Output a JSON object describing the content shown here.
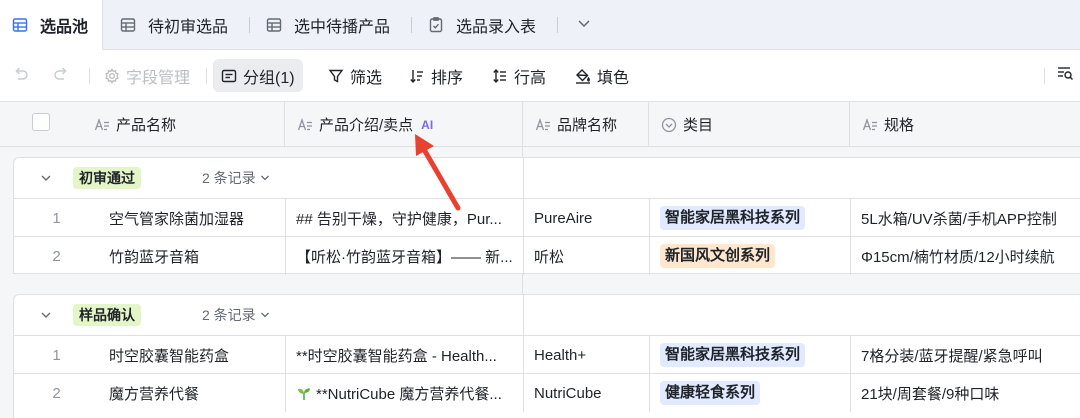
{
  "tabs": [
    {
      "label": "选品池",
      "icon": "table-icon",
      "active": true
    },
    {
      "label": "待初审选品",
      "icon": "table-icon",
      "active": false
    },
    {
      "label": "选中待播产品",
      "icon": "table-icon",
      "active": false
    },
    {
      "label": "选品录入表",
      "icon": "form-icon",
      "active": false
    }
  ],
  "toolbar": {
    "field_manage": "字段管理",
    "group": "分组(1)",
    "filter": "筛选",
    "sort": "排序",
    "row_height": "行高",
    "fill": "填色"
  },
  "columns": [
    {
      "label": "产品名称",
      "icon": "text-field-icon"
    },
    {
      "label": "产品介绍/卖点",
      "icon": "text-field-icon",
      "badge": "AI"
    },
    {
      "label": "品牌名称",
      "icon": "text-field-icon"
    },
    {
      "label": "类目",
      "icon": "single-select-icon"
    },
    {
      "label": "规格",
      "icon": "text-field-icon"
    }
  ],
  "groups": [
    {
      "label": "初审通过",
      "count": "2 条记录",
      "rows": [
        {
          "index": "1",
          "name": "空气管家除菌加湿器",
          "intro": "## 告别干燥，守护健康，Pur...",
          "brand": "PureAire",
          "category": "智能家居黑科技系列",
          "category_color": "#e1eaff",
          "spec": "5L水箱/UV杀菌/手机APP控制"
        },
        {
          "index": "2",
          "name": "竹韵蓝牙音箱",
          "intro": "【听松·竹韵蓝牙音箱】—— 新...",
          "brand": "听松",
          "category": "新国风文创系列",
          "category_color": "#fee7cd",
          "spec": "Φ15cm/楠竹材质/12小时续航"
        }
      ]
    },
    {
      "label": "样品确认",
      "count": "2 条记录",
      "rows": [
        {
          "index": "1",
          "name": "时空胶囊智能药盒",
          "intro": "**时空胶囊智能药盒 - Health...",
          "brand": "Health+",
          "category": "智能家居黑科技系列",
          "category_color": "#e1eaff",
          "spec": "7格分装/蓝牙提醒/紧急呼叫"
        },
        {
          "index": "2",
          "name": "魔方营养代餐",
          "intro": "**NutriCube 魔方营养代餐...",
          "intro_icon": "seedling-icon",
          "brand": "NutriCube",
          "category": "健康轻食系列",
          "category_color": "#e1eaff",
          "spec": "21块/周套餐/9种口味"
        }
      ]
    }
  ],
  "colors": {
    "accent": "#3370ff",
    "group_tag_bg": "#e4f5c8",
    "arrow": "#e8412f",
    "ai_badge": "#7b67ee"
  }
}
